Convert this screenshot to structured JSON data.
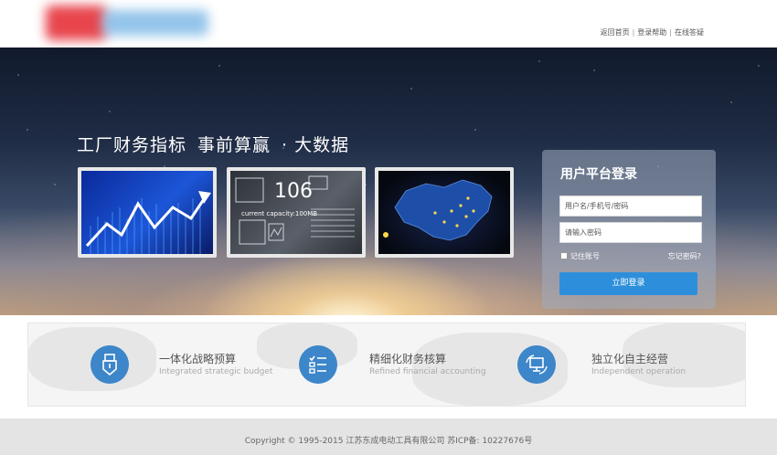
{
  "header": {
    "links": [
      "返回首页",
      "登录帮助",
      "在线答疑"
    ],
    "separator": "|"
  },
  "hero": {
    "title_part1": "工厂财务指标",
    "title_part2": "事前算赢",
    "title_part3": "· 大数据",
    "thumb2_number": "106",
    "thumb2_caption": "current capacity:100MB"
  },
  "login": {
    "title": "用户平台登录",
    "username_placeholder": "用户名/手机号/密码",
    "password_placeholder": "请输入密码",
    "remember_label": "记住账号",
    "forgot_label": "忘记密码?",
    "submit_label": "立即登录",
    "button_color": "#2d8fdb"
  },
  "features": [
    {
      "title": "一体化战略预算",
      "subtitle": "Integrated strategic budget",
      "icon": "usb-stick-icon"
    },
    {
      "title": "精细化财务核算",
      "subtitle": "Refined financial accounting",
      "icon": "checklist-icon"
    },
    {
      "title": "独立化自主经营",
      "subtitle": "Independent operation",
      "icon": "monitor-sync-icon"
    }
  ],
  "footer": {
    "copyright": "Copyright © 1995-2015 江苏东成电动工具有限公司 苏ICP备: 10227676号"
  },
  "colors": {
    "accent": "#3d86c9",
    "footer_bg": "#e4e4e4"
  }
}
